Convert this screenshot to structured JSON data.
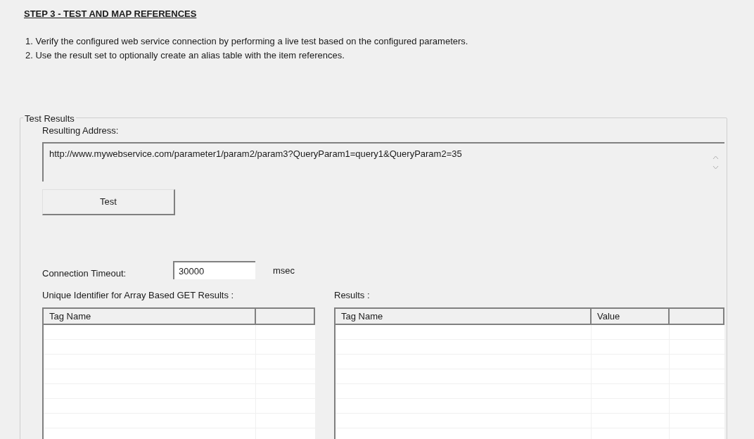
{
  "heading": "STEP 3 - TEST AND MAP REFERENCES",
  "instructions": [
    "1. Verify the configured web service connection by performing a live test based on the configured parameters.",
    "2. Use the result set to optionally create an alias table with the item references."
  ],
  "group": {
    "title": "Test Results",
    "address_label": "Resulting Address:",
    "address_value": "http://www.mywebservice.com/parameter1/param2/param3?QueryParam1=query1&QueryParam2=35",
    "test_button": "Test",
    "timeout_label": "Connection Timeout:",
    "timeout_value": "30000",
    "timeout_unit": "msec",
    "tables": [
      {
        "label": "Unique Identifier for Array Based GET Results :",
        "columns": [
          "Tag Name"
        ]
      },
      {
        "label": "Results :",
        "columns": [
          "Tag Name",
          "Value"
        ]
      }
    ]
  }
}
